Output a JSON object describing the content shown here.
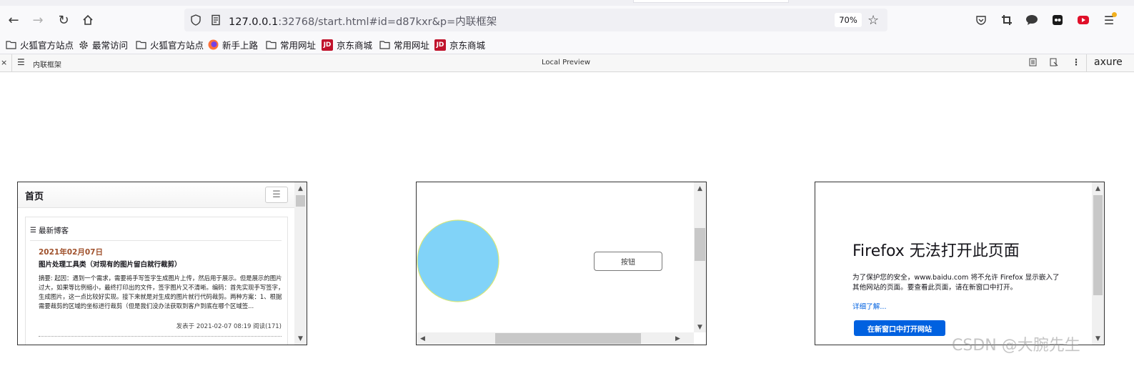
{
  "browser": {
    "url_host": "127.0.0.1",
    "url_rest": ":32768/start.html#id=d87kxr&p=内联框架",
    "zoom": "70%",
    "bookmarks": [
      "火狐官方站点",
      "最常访问",
      "火狐官方站点",
      "新手上路",
      "常用网址",
      "京东商城",
      "常用网址",
      "京东商城"
    ],
    "jd_label": "JD"
  },
  "axure": {
    "page_name": "内联框架",
    "preview_label": "Local Preview",
    "brand": "axure"
  },
  "frame1": {
    "title": "首页",
    "section": "最新博客",
    "date": "2021年02月07日",
    "post_title": "图片处理工具类（对现有的图片留白就行裁剪）",
    "summary": "摘要: 起因：遇到一个需求，需要将手写签字生成图片上传，然后用于展示。但是展示的图片过大，如果等比例缩小，最终打印出的文件，签字图片又不清晰。编码：首先实现手写签字，生成图片，这一点比较好实现。接下来就是对生成的图片就行代码裁剪。两种方案：1、根据需要裁剪的区域的坐标进行裁剪（但是我们没办法获取到客户到底在哪个区域签...",
    "meta": "发表于 2021-02-07 08:19 阅读(171)"
  },
  "frame2": {
    "button_label": "按钮",
    "circle_color": "#81d3f8"
  },
  "frame3": {
    "heading": "Firefox 无法打开此页面",
    "body": "为了保护您的安全，www.baidu.com 将不允许 Firefox 显示嵌入了其他网站的页面。要查看此页面，请在新窗口中打开。",
    "link": "详细了解...",
    "button": "在新窗口中打开网站"
  },
  "watermark": "CSDN @大腕先生"
}
